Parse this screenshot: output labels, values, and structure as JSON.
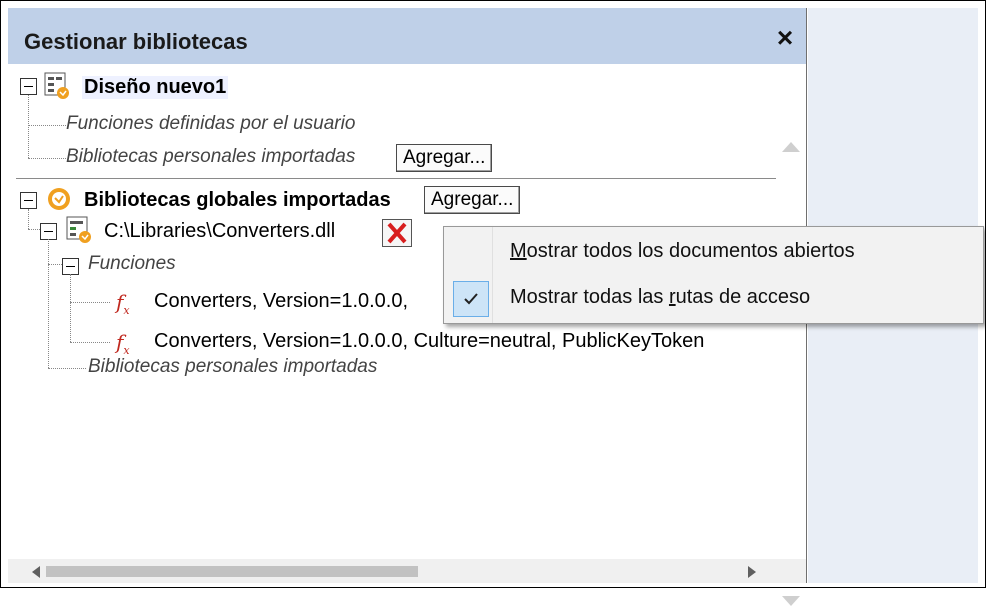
{
  "panel": {
    "title": "Gestionar bibliotecas",
    "close_glyph": "×"
  },
  "tree": {
    "design_name": "Diseño nuevo1",
    "user_functions": "Funciones definidas por el usuario",
    "personal_libs_local": "Bibliotecas personales importadas",
    "add_label": "Agregar...",
    "global_libs": "Bibliotecas globales importadas",
    "global_add_label": "Agregar...",
    "dll_path": "C:\\Libraries\\Converters.dll",
    "functions_label": "Funciones",
    "func1": "Converters, Version=1.0.0.0,",
    "func2": "Converters, Version=1.0.0.0, Culture=neutral, PublicKeyToken",
    "personal_libs_global": "Bibliotecas personales importadas"
  },
  "context_menu": {
    "item1_underline": "M",
    "item1_rest": "ostrar todos los documentos abiertos",
    "item2_a": "Mostrar todas las ",
    "item2_u": "r",
    "item2_b": "utas de acceso",
    "item2_checked": true
  },
  "icons": {
    "expander": "collapse-box-icon",
    "design": "mapping-design-icon",
    "global": "clock-badge-icon",
    "dll": "library-file-icon",
    "delete": "red-x-delete-icon",
    "function": "fx-function-icon",
    "check": "checkmark-icon"
  },
  "colors": {
    "title_bar": "#bfd0e8",
    "delete_red": "#d81e1e",
    "menu_check_bg": "#cde4f7",
    "global_icon": "#f0a020"
  }
}
